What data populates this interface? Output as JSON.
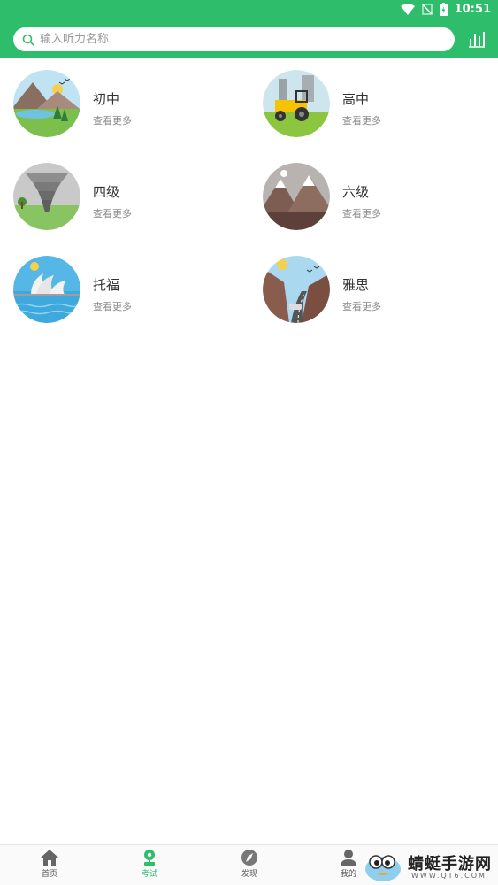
{
  "status_bar": {
    "time": "10:51"
  },
  "search": {
    "placeholder": "输入听力名称"
  },
  "categories": [
    {
      "title": "初中",
      "more": "查看更多",
      "icon": "mountain-lake-scene"
    },
    {
      "title": "高中",
      "more": "查看更多",
      "icon": "tractor-scene"
    },
    {
      "title": "四级",
      "more": "查看更多",
      "icon": "tornado-scene"
    },
    {
      "title": "六级",
      "more": "查看更多",
      "icon": "snowy-mountains-scene"
    },
    {
      "title": "托福",
      "more": "查看更多",
      "icon": "opera-house-scene"
    },
    {
      "title": "雅思",
      "more": "查看更多",
      "icon": "canyon-road-scene"
    }
  ],
  "tabbar": {
    "home": "首页",
    "exam": "考试",
    "discover": "发现",
    "mine": "我的"
  },
  "watermark": {
    "text": "蜻蜓手游网",
    "url": "WWW.QT6.COM"
  },
  "colors": {
    "accent": "#2ebd6b"
  }
}
